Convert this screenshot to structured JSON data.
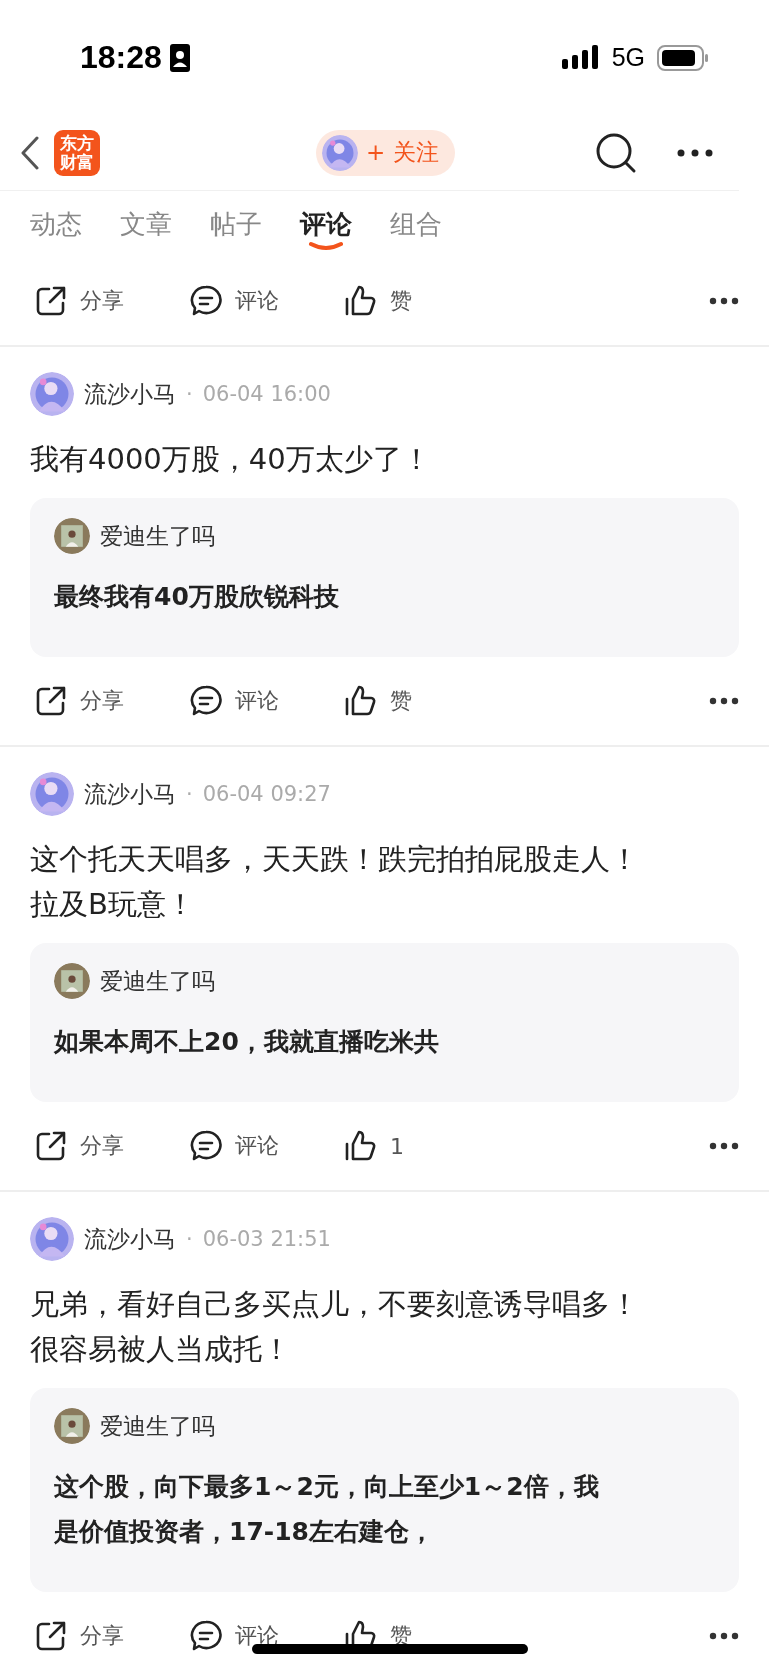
{
  "status_bar": {
    "time": "18:28",
    "network": "5G"
  },
  "nav": {
    "logo": [
      "东方",
      "财富"
    ],
    "follow": "+ 关注"
  },
  "tabs": [
    {
      "label": "动态",
      "selected": false
    },
    {
      "label": "文章",
      "selected": false
    },
    {
      "label": "帖子",
      "selected": false
    },
    {
      "label": "评论",
      "selected": true
    },
    {
      "label": "组合",
      "selected": false
    }
  ],
  "top_actions": {
    "share": "分享",
    "comment": "评论",
    "like": "赞"
  },
  "posts": [
    {
      "author": "流沙小马",
      "separator": "·",
      "time": "06-04 16:00",
      "text": "我有4000万股，40万太少了！",
      "quote": {
        "author": "爱迪生了吗",
        "text": "最终我有40万股欣锐科技"
      },
      "actions": {
        "share": "分享",
        "comment": "评论",
        "like": "赞"
      }
    },
    {
      "author": "流沙小马",
      "separator": "·",
      "time": "06-04 09:27",
      "text": "这个托天天唱多，天天跌！跌完拍拍屁股走人！拉及B玩意！",
      "quote": {
        "author": "爱迪生了吗",
        "text": "如果本周不上20，我就直播吃米共"
      },
      "actions": {
        "share": "分享",
        "comment": "评论",
        "like": "1"
      }
    },
    {
      "author": "流沙小马",
      "separator": "·",
      "time": "06-03 21:51",
      "text": "兄弟，看好自己多买点儿，不要刻意诱导唱多！很容易被人当成托！",
      "quote": {
        "author": "爱迪生了吗",
        "text": "这个股，向下最多1～2元，向上至少1～2倍，我是价值投资者，17-18左右建仓，"
      },
      "actions": {
        "share": "分享",
        "comment": "评论",
        "like": "赞"
      }
    }
  ]
}
